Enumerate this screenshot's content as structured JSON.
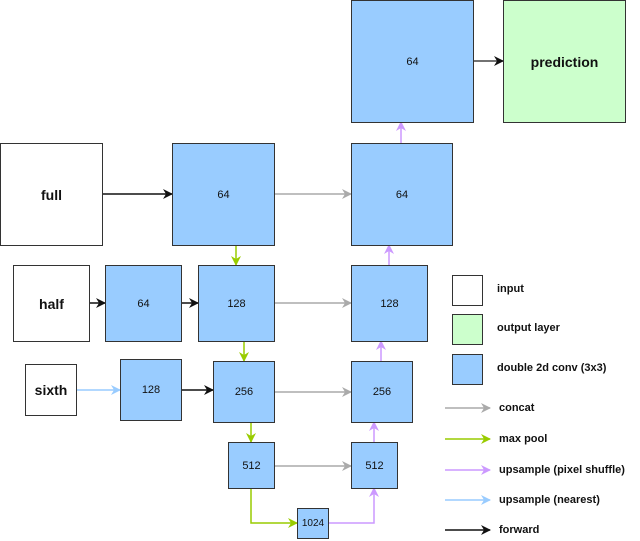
{
  "colors": {
    "input_fill": "#ffffff",
    "output_fill": "#ccffcc",
    "conv_fill": "#99ccff",
    "concat": "#aaaaaa",
    "max_pool": "#99cc00",
    "upsample_pixel_shuffle": "#cc99ff",
    "upsample_nearest": "#99ccff",
    "forward": "#111111"
  },
  "nodes": {
    "full": "full",
    "half": "half",
    "sixth": "sixth",
    "enc_full": "64",
    "half_pre": "64",
    "enc_half": "128",
    "sixth_pre": "128",
    "enc_sixth": "256",
    "enc_512": "512",
    "bottleneck": "1024",
    "dec_512": "512",
    "dec_256": "256",
    "dec_128": "128",
    "dec_64": "64",
    "head_64": "64",
    "prediction": "prediction"
  },
  "legend": {
    "input": "input",
    "output_layer": "output layer",
    "double_conv": "double 2d conv (3x3)",
    "concat": "concat",
    "max_pool": "max pool",
    "upsample_pixel_shuffle": "upsample (pixel shuffle)",
    "upsample_nearest": "upsample (nearest)",
    "forward": "forward"
  }
}
